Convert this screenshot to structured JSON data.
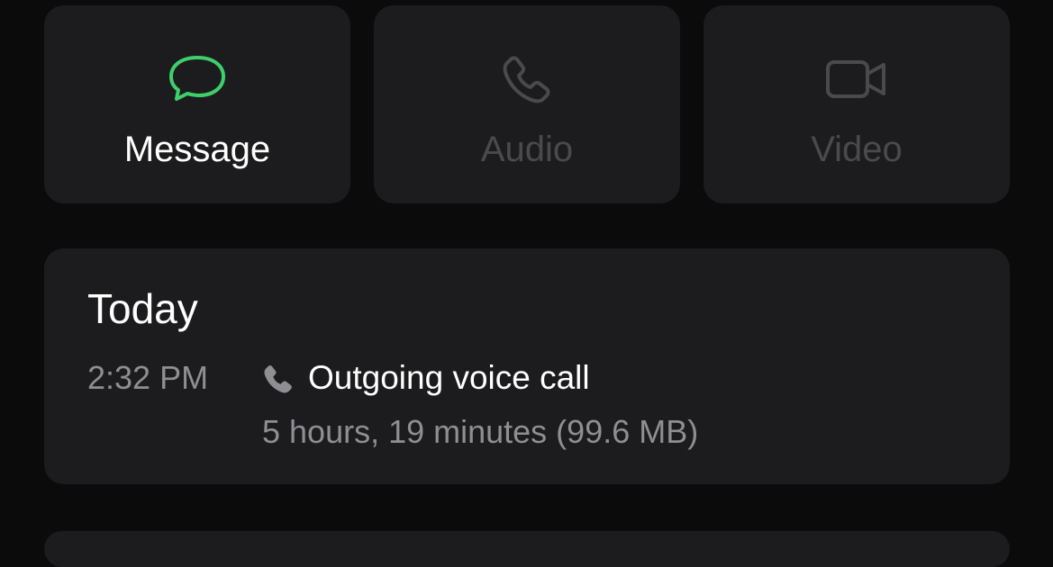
{
  "actions": {
    "message": {
      "label": "Message",
      "icon": "message-bubble-icon",
      "enabled": true,
      "icon_color": "#3ecf6b"
    },
    "audio": {
      "label": "Audio",
      "icon": "phone-icon",
      "enabled": false
    },
    "video": {
      "label": "Video",
      "icon": "video-camera-icon",
      "enabled": false
    }
  },
  "colors": {
    "background": "#0b0b0b",
    "card": "#1c1c1e",
    "disabled": "#4a4a4c",
    "secondary_text": "#8e8e93"
  },
  "call_history": {
    "title": "Today",
    "entries": [
      {
        "time": "2:32 PM",
        "icon": "phone-icon",
        "type": "Outgoing voice call",
        "details": "5 hours, 19 minutes (99.6 MB)"
      }
    ]
  }
}
